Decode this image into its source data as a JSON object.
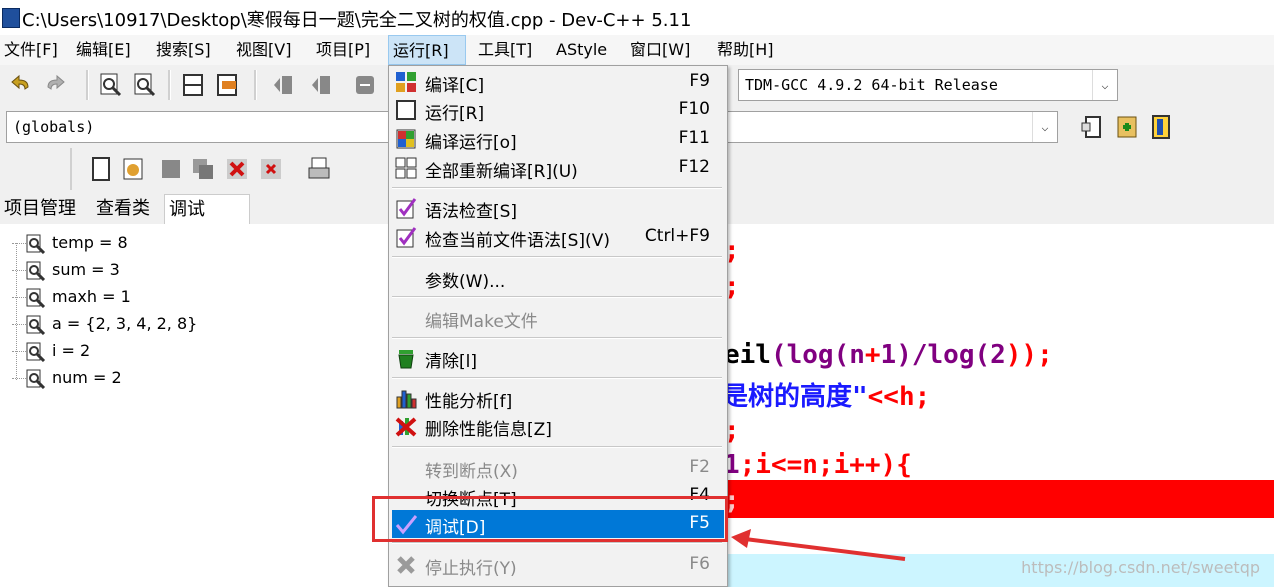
{
  "window": {
    "title": "C:\\Users\\10917\\Desktop\\寒假每日一题\\完全二叉树的权值.cpp - Dev-C++ 5.11"
  },
  "menubar": {
    "items": [
      {
        "label": "文件[F]"
      },
      {
        "label": "编辑[E]"
      },
      {
        "label": "搜索[S]"
      },
      {
        "label": "视图[V]"
      },
      {
        "label": "项目[P]"
      },
      {
        "label": "运行[R]"
      },
      {
        "label": "工具[T]"
      },
      {
        "label": "AStyle"
      },
      {
        "label": "窗口[W]"
      },
      {
        "label": "帮助[H]"
      }
    ]
  },
  "toolbar": {
    "compiler_select": "TDM-GCC 4.9.2 64-bit Release",
    "scope_select": "(globals)"
  },
  "left_tabs": [
    {
      "label": "项目管理"
    },
    {
      "label": "查看类"
    },
    {
      "label": "调试"
    }
  ],
  "watch": {
    "items": [
      {
        "label": "temp = 8"
      },
      {
        "label": "sum = 3"
      },
      {
        "label": "maxh = 1"
      },
      {
        "label": "a = {2, 3, 4, 2, 8}"
      },
      {
        "label": "i = 2"
      },
      {
        "label": "num = 2"
      }
    ]
  },
  "run_menu": {
    "items": [
      {
        "label": "编译[C]",
        "shortcut": "F9",
        "disabled": false,
        "icon": "compile-grid-icon"
      },
      {
        "label": "运行[R]",
        "shortcut": "F10",
        "disabled": false,
        "icon": "run-window-icon"
      },
      {
        "label": "编译运行[o]",
        "shortcut": "F11",
        "disabled": false,
        "icon": "compile-run-icon"
      },
      {
        "label": "全部重新编译[R](U)",
        "shortcut": "F12",
        "disabled": false,
        "icon": "rebuild-all-icon"
      },
      {
        "label": "语法检查[S]",
        "shortcut": "",
        "disabled": false,
        "icon": "syntax-check-icon"
      },
      {
        "label": "检查当前文件语法[S](V)",
        "shortcut": "Ctrl+F9",
        "disabled": false,
        "icon": "file-syntax-check-icon"
      },
      {
        "label": "参数(W)...",
        "shortcut": "",
        "disabled": false,
        "icon": ""
      },
      {
        "label": "编辑Make文件",
        "shortcut": "",
        "disabled": true,
        "icon": ""
      },
      {
        "label": "清除[l]",
        "shortcut": "",
        "disabled": false,
        "icon": "clean-bin-icon"
      },
      {
        "label": "性能分析[f]",
        "shortcut": "",
        "disabled": false,
        "icon": "profile-chart-icon"
      },
      {
        "label": "删除性能信息[Z]",
        "shortcut": "",
        "disabled": false,
        "icon": "delete-profile-icon"
      },
      {
        "label": "转到断点(X)",
        "shortcut": "F2",
        "disabled": true,
        "icon": ""
      },
      {
        "label": "切换断点[T]",
        "shortcut": "F4",
        "disabled": false,
        "icon": ""
      },
      {
        "label": "调试[D]",
        "shortcut": "F5",
        "disabled": false,
        "icon": "debug-check-icon",
        "highlighted": true
      },
      {
        "label": "停止执行(Y)",
        "shortcut": "F6",
        "disabled": true,
        "icon": "stop-x-icon"
      }
    ]
  },
  "code_fragments": {
    "l1": ";",
    "l2": ";",
    "l3a": "eil",
    "l3b": "(log(n",
    "l3c": "+",
    "l3d": "1",
    "l3e": ")/log(",
    "l3f": "2",
    "l3g": "));",
    "l4a": "是树的高度\"",
    "l4b": "<<h;",
    "l5": ";",
    "l6a": "1",
    "l6b": ";i<=n;i++){",
    "l7": ";"
  },
  "watermark": "https://blog.csdn.net/sweetqp",
  "colors": {
    "menu_highlight": "#0078d7",
    "breakpoint_line": "#ff0000",
    "current_line": "#ccf5ff",
    "callout": "#e03030"
  }
}
